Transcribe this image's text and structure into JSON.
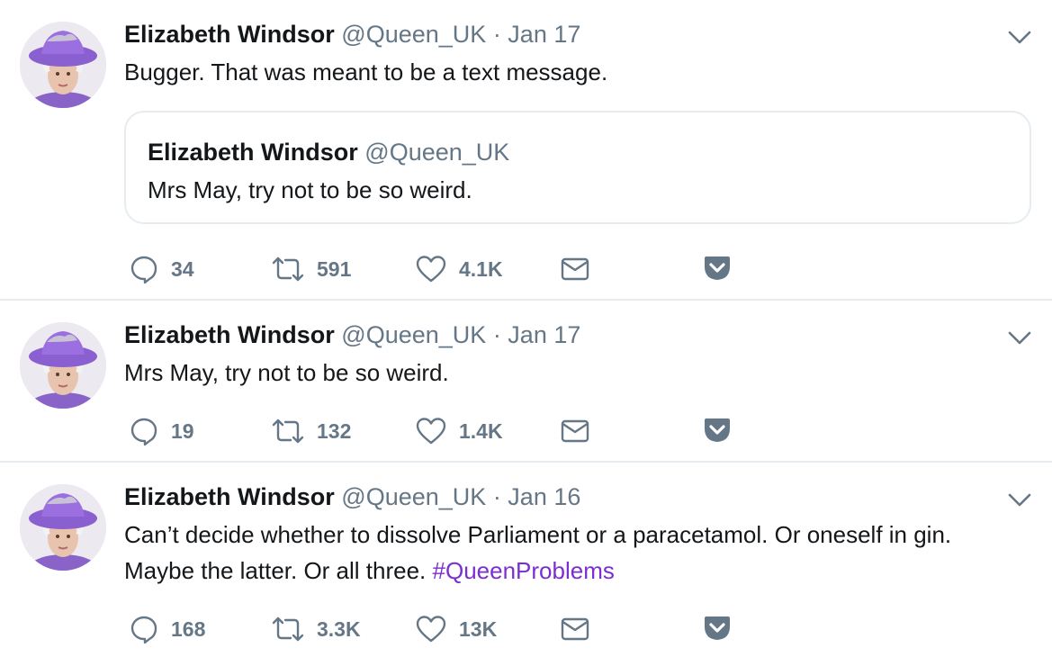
{
  "colors": {
    "text": "#14171a",
    "meta": "#657786",
    "hashtag": "#7b2ed1",
    "icon": "#657786",
    "divider": "#e6ecf0"
  },
  "tweets": [
    {
      "name": "Elizabeth Windsor",
      "handle": "@Queen_UK",
      "date": "· Jan 17",
      "text": "Bugger. That was meant to be a text message.",
      "quote": {
        "name": "Elizabeth Windsor",
        "handle": "@Queen_UK",
        "text": "Mrs May, try not to be so weird."
      },
      "replies": "34",
      "retweets": "591",
      "likes": "4.1K"
    },
    {
      "name": "Elizabeth Windsor",
      "handle": "@Queen_UK",
      "date": "· Jan 17",
      "text": "Mrs May, try not to be so weird.",
      "replies": "19",
      "retweets": "132",
      "likes": "1.4K"
    },
    {
      "name": "Elizabeth Windsor",
      "handle": "@Queen_UK",
      "date": "· Jan 16",
      "text_line1": "Can’t decide whether to dissolve Parliament or a paracetamol. Or oneself in gin.",
      "text_line2": "Maybe the latter. Or all three.",
      "hashtag": "#QueenProblems",
      "replies": "168",
      "retweets": "3.3K",
      "likes": "13K"
    }
  ],
  "icons": [
    "avatar",
    "chevron-down-icon",
    "reply-icon",
    "retweet-icon",
    "like-icon",
    "direct-message-icon",
    "pocket-icon"
  ]
}
